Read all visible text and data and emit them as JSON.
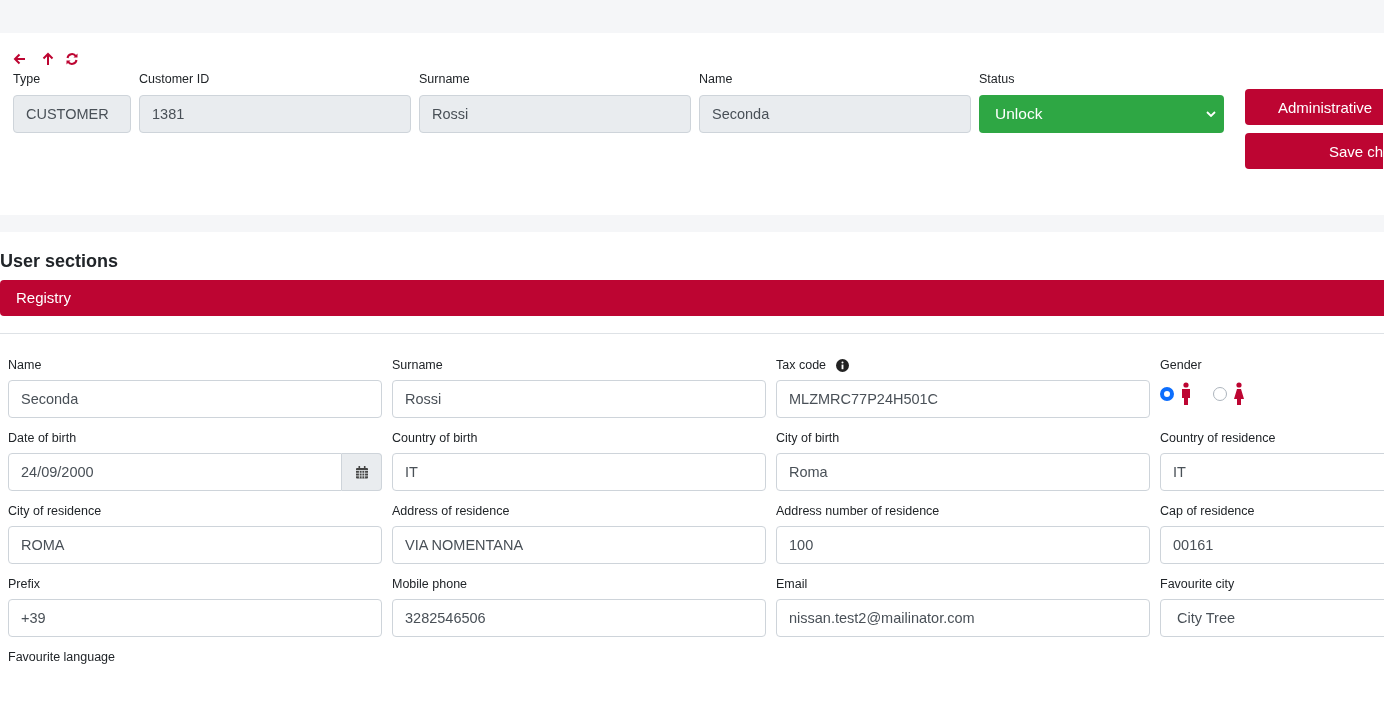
{
  "header_fields": [
    {
      "label": "Type",
      "value": "CUSTOMER",
      "kind": "readonly"
    },
    {
      "label": "Customer ID",
      "value": "1381",
      "kind": "readonly"
    },
    {
      "label": "Surname",
      "value": "Rossi",
      "kind": "readonly"
    },
    {
      "label": "Name",
      "value": "Seconda",
      "kind": "readonly"
    },
    {
      "label": "Status",
      "value": "Unlock",
      "kind": "status-select"
    }
  ],
  "actions": [
    "Administrative",
    "Save ch"
  ],
  "section_title": "User sections",
  "accordion": {
    "title": "Registry"
  },
  "fields": [
    {
      "label": "Name",
      "value": "Seconda",
      "kind": "text",
      "info": false
    },
    {
      "label": "Surname",
      "value": "Rossi",
      "kind": "text",
      "info": false
    },
    {
      "label": "Tax code",
      "value": "MLZMRC77P24H501C",
      "kind": "text",
      "info": true
    },
    {
      "label": "Gender",
      "kind": "gender",
      "info": false,
      "options": [
        {
          "selected": true
        },
        {
          "selected": false
        }
      ]
    },
    {
      "label": "Date of birth",
      "value": "24/09/2000",
      "kind": "date",
      "info": false
    },
    {
      "label": "Country of birth",
      "value": "IT",
      "kind": "text",
      "info": false
    },
    {
      "label": "City of birth",
      "value": "Roma",
      "kind": "text",
      "info": false
    },
    {
      "label": "Country of residence",
      "value": "IT",
      "kind": "text",
      "info": false
    },
    {
      "label": "City of residence",
      "value": "ROMA",
      "kind": "text",
      "info": false
    },
    {
      "label": "Address of residence",
      "value": "VIA NOMENTANA",
      "kind": "text",
      "info": false
    },
    {
      "label": "Address number of residence",
      "value": "100",
      "kind": "text",
      "info": false
    },
    {
      "label": "Cap of residence",
      "value": "00161",
      "kind": "text",
      "info": false
    },
    {
      "label": "Prefix",
      "value": "+39",
      "kind": "text",
      "info": false
    },
    {
      "label": "Mobile phone",
      "value": "3282546506",
      "kind": "text",
      "info": false
    },
    {
      "label": "Email",
      "value": "nissan.test2@mailinator.com",
      "kind": "text",
      "info": false
    },
    {
      "label": "Favourite city",
      "value": "City Tree",
      "kind": "select",
      "info": false
    },
    {
      "label": "Favourite language",
      "kind": "label-only",
      "info": false
    }
  ]
}
